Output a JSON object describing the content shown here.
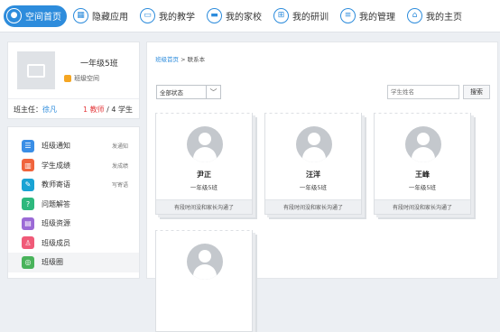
{
  "nav": {
    "items": [
      {
        "label": "空间首页",
        "icon": "person-icon",
        "active": true
      },
      {
        "label": "隐藏应用",
        "icon": "grid-icon"
      },
      {
        "label": "我的教学",
        "icon": "board-icon"
      },
      {
        "label": "我的家校",
        "icon": "screen-icon"
      },
      {
        "label": "我的研训",
        "icon": "apps-icon"
      },
      {
        "label": "我的管理",
        "icon": "doc-icon"
      },
      {
        "label": "我的主页",
        "icon": "home-icon"
      }
    ]
  },
  "class_card": {
    "name": "一年级5班",
    "space_label": "班级空间",
    "teacher_label": "班主任：",
    "teacher_name": "徐凡",
    "teacher_count": "1 教师",
    "count_sep": " / ",
    "student_count": "4 学生"
  },
  "menu": {
    "items": [
      {
        "label": "班级通知",
        "sub": "发通知",
        "color": "#3a8ee6",
        "icon": "notice-icon",
        "glyph": "☰"
      },
      {
        "label": "学生成绩",
        "sub": "发成绩",
        "color": "#f0643c",
        "icon": "bar-chart-icon",
        "glyph": "▥"
      },
      {
        "label": "教师寄语",
        "sub": "写寄语",
        "color": "#1aa3d4",
        "icon": "message-icon",
        "glyph": "✎"
      },
      {
        "label": "问题解答",
        "sub": "",
        "color": "#2db87d",
        "icon": "question-icon",
        "glyph": "?"
      },
      {
        "label": "班级资源",
        "sub": "",
        "color": "#9b6ad6",
        "icon": "resource-icon",
        "glyph": "▤"
      },
      {
        "label": "班级成员",
        "sub": "",
        "color": "#f05a78",
        "icon": "members-icon",
        "glyph": "♙"
      },
      {
        "label": "班级圈",
        "sub": "",
        "color": "#49b35b",
        "icon": "circle-icon",
        "glyph": "◎"
      }
    ]
  },
  "breadcrumb": {
    "home": "班级首页",
    "sep": " > ",
    "current": "联系本"
  },
  "filter": {
    "value": "全部状态",
    "caret": "﹀"
  },
  "search": {
    "placeholder": "学生姓名",
    "button": "搜索"
  },
  "students": [
    {
      "name": "尹正",
      "class": "一年级5班",
      "status": "有段时间没和家长沟通了"
    },
    {
      "name": "汪洋",
      "class": "一年级5班",
      "status": "有段时间没和家长沟通了"
    },
    {
      "name": "王峰",
      "class": "一年级5班",
      "status": "有段时间没和家长沟通了"
    },
    {
      "name": "",
      "class": "",
      "status": ""
    }
  ]
}
